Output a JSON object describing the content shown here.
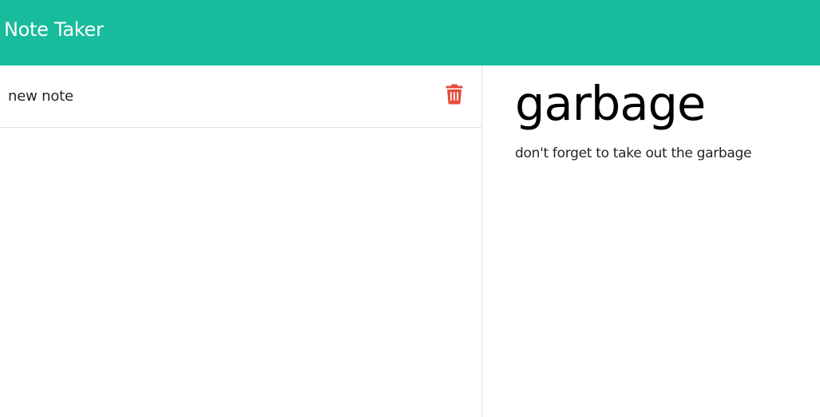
{
  "navbar": {
    "brand": "Note Taker",
    "color": "#18bc9c"
  },
  "notes_list": {
    "items": [
      {
        "title": "new note",
        "delete_icon": "trash-icon",
        "delete_icon_color": "#e74c3c"
      }
    ]
  },
  "editor": {
    "title": "garbage",
    "body": "don't forget to take out the garbage"
  }
}
